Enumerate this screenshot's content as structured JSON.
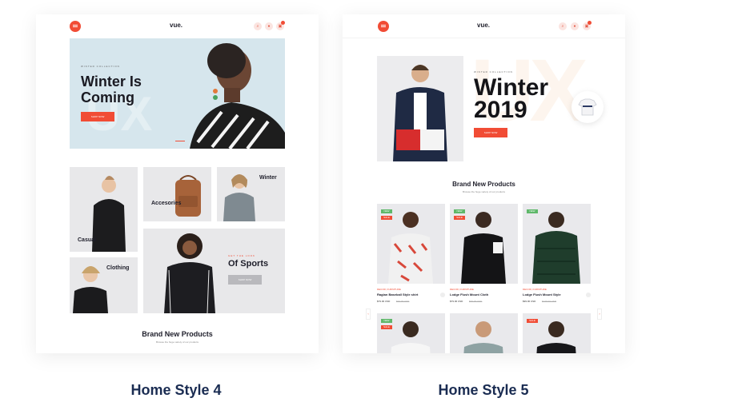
{
  "captions": {
    "home4": "Home Style 4",
    "home5": "Home Style 5"
  },
  "brand": {
    "logo": "vue.",
    "accent": "#f14c35",
    "caption_color": "#1a2c52"
  },
  "home4": {
    "hero": {
      "eyebrow": "WINTER COLLECTION",
      "title": "Winter Is Coming",
      "cta": "SHOP NOW",
      "ghost": "UX"
    },
    "categories": {
      "casual": "Casual",
      "accessories": "Accesories",
      "winter": "Winter",
      "clothing": "Clothing",
      "sports_eyebrow": "GET THE LOOK",
      "sports_title": "Of Sports",
      "sports_cta": "SHOP NOW"
    },
    "section": {
      "title": "Brand New Products",
      "subtitle": "Browse the huge variety of our products"
    }
  },
  "home5": {
    "hero": {
      "eyebrow": "WINTER COLLECTION",
      "title_line1": "Winter",
      "title_line2": "2019",
      "cta": "SHOP NOW",
      "ghost": "UX"
    },
    "section": {
      "title": "Brand New Products",
      "subtitle": "Browse the huge variety of our products"
    },
    "tags": {
      "new": "NEW",
      "sale": "SALE"
    },
    "products": [
      {
        "category": "DECOR, FURNITURE",
        "name": "Raglan Baseball Style shirt",
        "price": "$79.00 USD",
        "old_price": "$99.00 USD"
      },
      {
        "category": "DECOR, FURNITURE",
        "name": "Lodge Flush Mount Cloth",
        "price": "$79.00 USD",
        "old_price": "$99.00 USD"
      },
      {
        "category": "DECOR, FURNITURE",
        "name": "Lodge Flush Mount Style",
        "price": "$99.00 USD",
        "old_price": "$129.00 USD"
      }
    ]
  }
}
